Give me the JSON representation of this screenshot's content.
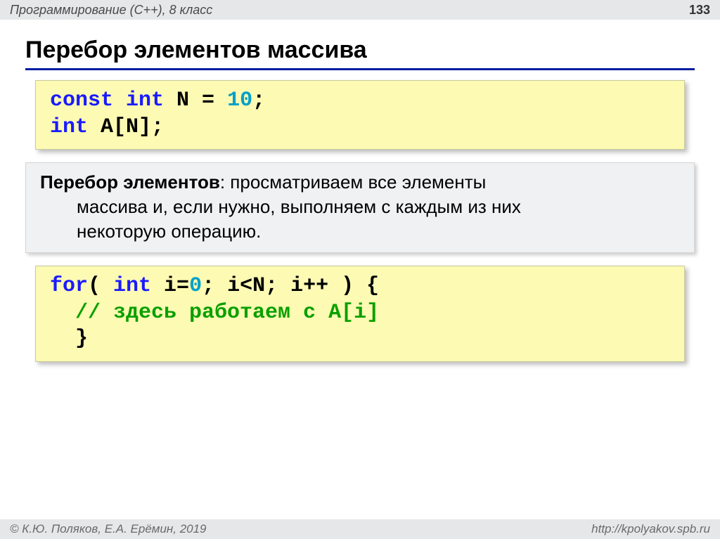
{
  "header": {
    "left": "Программирование (C++), 8 класс",
    "page": "133"
  },
  "title": "Перебор элементов массива",
  "code1": {
    "l1_kw1": "const",
    "l1_kw2": "int",
    "l1_pln1": " N = ",
    "l1_num": "10",
    "l1_pln2": ";",
    "l2_kw": "int",
    "l2_pln": " A[N];"
  },
  "definition": {
    "lead": "Перебор элементов",
    "rest_line1": ": просматриваем все элементы",
    "rest_line2": "массива и, если нужно, выполняем с каждым из них",
    "rest_line3": "некоторую операцию."
  },
  "code2": {
    "l1_kw1": "for",
    "l1_pln1": "( ",
    "l1_kw2": "int",
    "l1_pln2": " i=",
    "l1_num": "0",
    "l1_pln3": "; i<N; i++ ) {",
    "l2_cmt": "  // здесь работаем с A[i]",
    "l3_pln": "  }"
  },
  "footer": {
    "left": "© К.Ю. Поляков, Е.А. Ерёмин, 2019",
    "right": "http://kpolyakov.spb.ru"
  }
}
